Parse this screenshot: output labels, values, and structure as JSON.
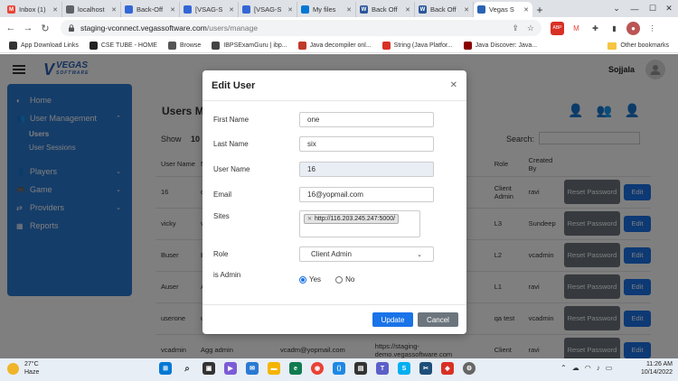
{
  "browser": {
    "tabs": [
      {
        "title": "Inbox (1)",
        "color": "#ea4335",
        "letter": "M",
        "active": false
      },
      {
        "title": "localhost",
        "color": "#5f6368",
        "letter": "",
        "active": false
      },
      {
        "title": "Back-Off",
        "color": "#3367d6",
        "letter": "",
        "active": false
      },
      {
        "title": "[VSAG-S",
        "color": "#3367d6",
        "letter": "",
        "active": false
      },
      {
        "title": "[VSAG-S",
        "color": "#3367d6",
        "letter": "",
        "active": false
      },
      {
        "title": "My files",
        "color": "#0078d4",
        "letter": "",
        "active": false
      },
      {
        "title": "Back Off",
        "color": "#2b579a",
        "letter": "W",
        "active": false
      },
      {
        "title": "Back Off",
        "color": "#2b579a",
        "letter": "W",
        "active": false
      },
      {
        "title": "Vegas S",
        "color": "#2a63b5",
        "letter": "",
        "active": true
      }
    ],
    "url_host": "staging-vconnect.vegassoftware.com",
    "url_path": "/users/manage",
    "bookmarks": [
      {
        "label": "App Download Links",
        "color": "#333"
      },
      {
        "label": "CSE TUBE - HOME",
        "color": "#222"
      },
      {
        "label": "Browse",
        "color": "#555"
      },
      {
        "label": "IBPSExamGuru | ibp...",
        "color": "#444"
      },
      {
        "label": "Java decompiler onl...",
        "color": "#c0392b"
      },
      {
        "label": "String (Java Platfor...",
        "color": "#d93025"
      },
      {
        "label": "Java Discover: Java...",
        "color": "#8b0000"
      }
    ],
    "other_bookmarks": "Other bookmarks"
  },
  "header": {
    "logo_main": "VEGAS",
    "logo_sub": "SOFTWARE",
    "user_name": "Sojjala"
  },
  "sidebar": {
    "items": [
      {
        "label": "Home",
        "icon": "palette-icon"
      },
      {
        "label": "User Management",
        "icon": "users-icon"
      }
    ],
    "sub_items": [
      {
        "label": "Users",
        "active": true
      },
      {
        "label": "User Sessions",
        "active": false
      }
    ],
    "items2": [
      {
        "label": "Players",
        "icon": "user-icon"
      },
      {
        "label": "Game",
        "icon": "gamepad-icon"
      },
      {
        "label": "Providers",
        "icon": "exchange-icon"
      },
      {
        "label": "Reports",
        "icon": "chart-icon"
      }
    ]
  },
  "page": {
    "title": "Users M",
    "show_label": "Show",
    "show_count": "10",
    "search_label": "Search:"
  },
  "table": {
    "headers": [
      "User Name",
      "N",
      "",
      "",
      "Role",
      "Created By",
      ""
    ],
    "rows": [
      {
        "username": "16",
        "name": "or",
        "email": "",
        "sites": "",
        "role": "Client Admin",
        "created_by": "ravi"
      },
      {
        "username": "vicky",
        "name": "vi",
        "email": "",
        "sites": "",
        "role": "L3",
        "created_by": "Sundeep"
      },
      {
        "username": "Buser",
        "name": "Be",
        "email": "",
        "sites": "",
        "role": "L2",
        "created_by": "vcadmin"
      },
      {
        "username": "Auser",
        "name": "Ac",
        "email": "",
        "sites": "",
        "role": "L1",
        "created_by": "ravi"
      },
      {
        "username": "userone",
        "name": "us",
        "email": "",
        "sites": "",
        "role": "qa test",
        "created_by": "vcadmin"
      },
      {
        "username": "vcadmin",
        "name": "Agg admin",
        "email": "vcadm@yopmail.com",
        "sites": "https://staging-demo.vegassoftware.com",
        "role": "Client",
        "created_by": "ravi"
      }
    ],
    "reset_label": "Reset Password",
    "edit_label": "Edit"
  },
  "modal": {
    "title": "Edit User",
    "fields": {
      "first_name_label": "First Name",
      "first_name_value": "one",
      "last_name_label": "Last Name",
      "last_name_value": "six",
      "user_name_label": "User Name",
      "user_name_value": "16",
      "email_label": "Email",
      "email_value": "16@yopmail.com",
      "sites_label": "Sites",
      "sites_chip": "http://116.203.245.247:5000/",
      "role_label": "Role",
      "role_value": "Client Admin",
      "is_admin_label": "is Admin",
      "yes_label": "Yes",
      "no_label": "No"
    },
    "is_admin": true,
    "update_label": "Update",
    "cancel_label": "Cancel"
  },
  "taskbar": {
    "temperature": "27°C",
    "weather": "Haze",
    "time": "11:26 AM",
    "date": "10/14/2022"
  }
}
